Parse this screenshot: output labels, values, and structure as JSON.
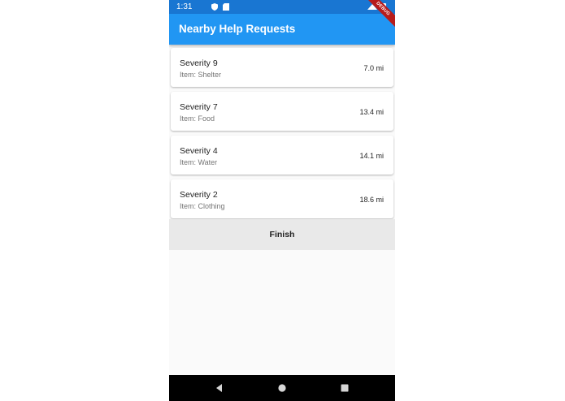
{
  "status_bar": {
    "time": "1:31",
    "left_icons": [
      "shield-icon",
      "sd-card-icon"
    ],
    "right_icons": [
      "wifi-icon",
      "battery-icon"
    ]
  },
  "app_bar": {
    "title": "Nearby Help Requests",
    "background": "#2196f3",
    "debug_banner": "DEBUG"
  },
  "requests": [
    {
      "title": "Severity 9",
      "item": "Item: Shelter",
      "distance": "7.0 mi"
    },
    {
      "title": "Severity 7",
      "item": "Item: Food",
      "distance": "13.4 mi"
    },
    {
      "title": "Severity 4",
      "item": "Item: Water",
      "distance": "14.1 mi"
    },
    {
      "title": "Severity 2",
      "item": "Item: Clothing",
      "distance": "18.6 mi"
    }
  ],
  "finish_button": {
    "label": "Finish"
  },
  "nav_bar": {
    "icons": [
      "back-icon",
      "home-icon",
      "recents-icon"
    ]
  }
}
